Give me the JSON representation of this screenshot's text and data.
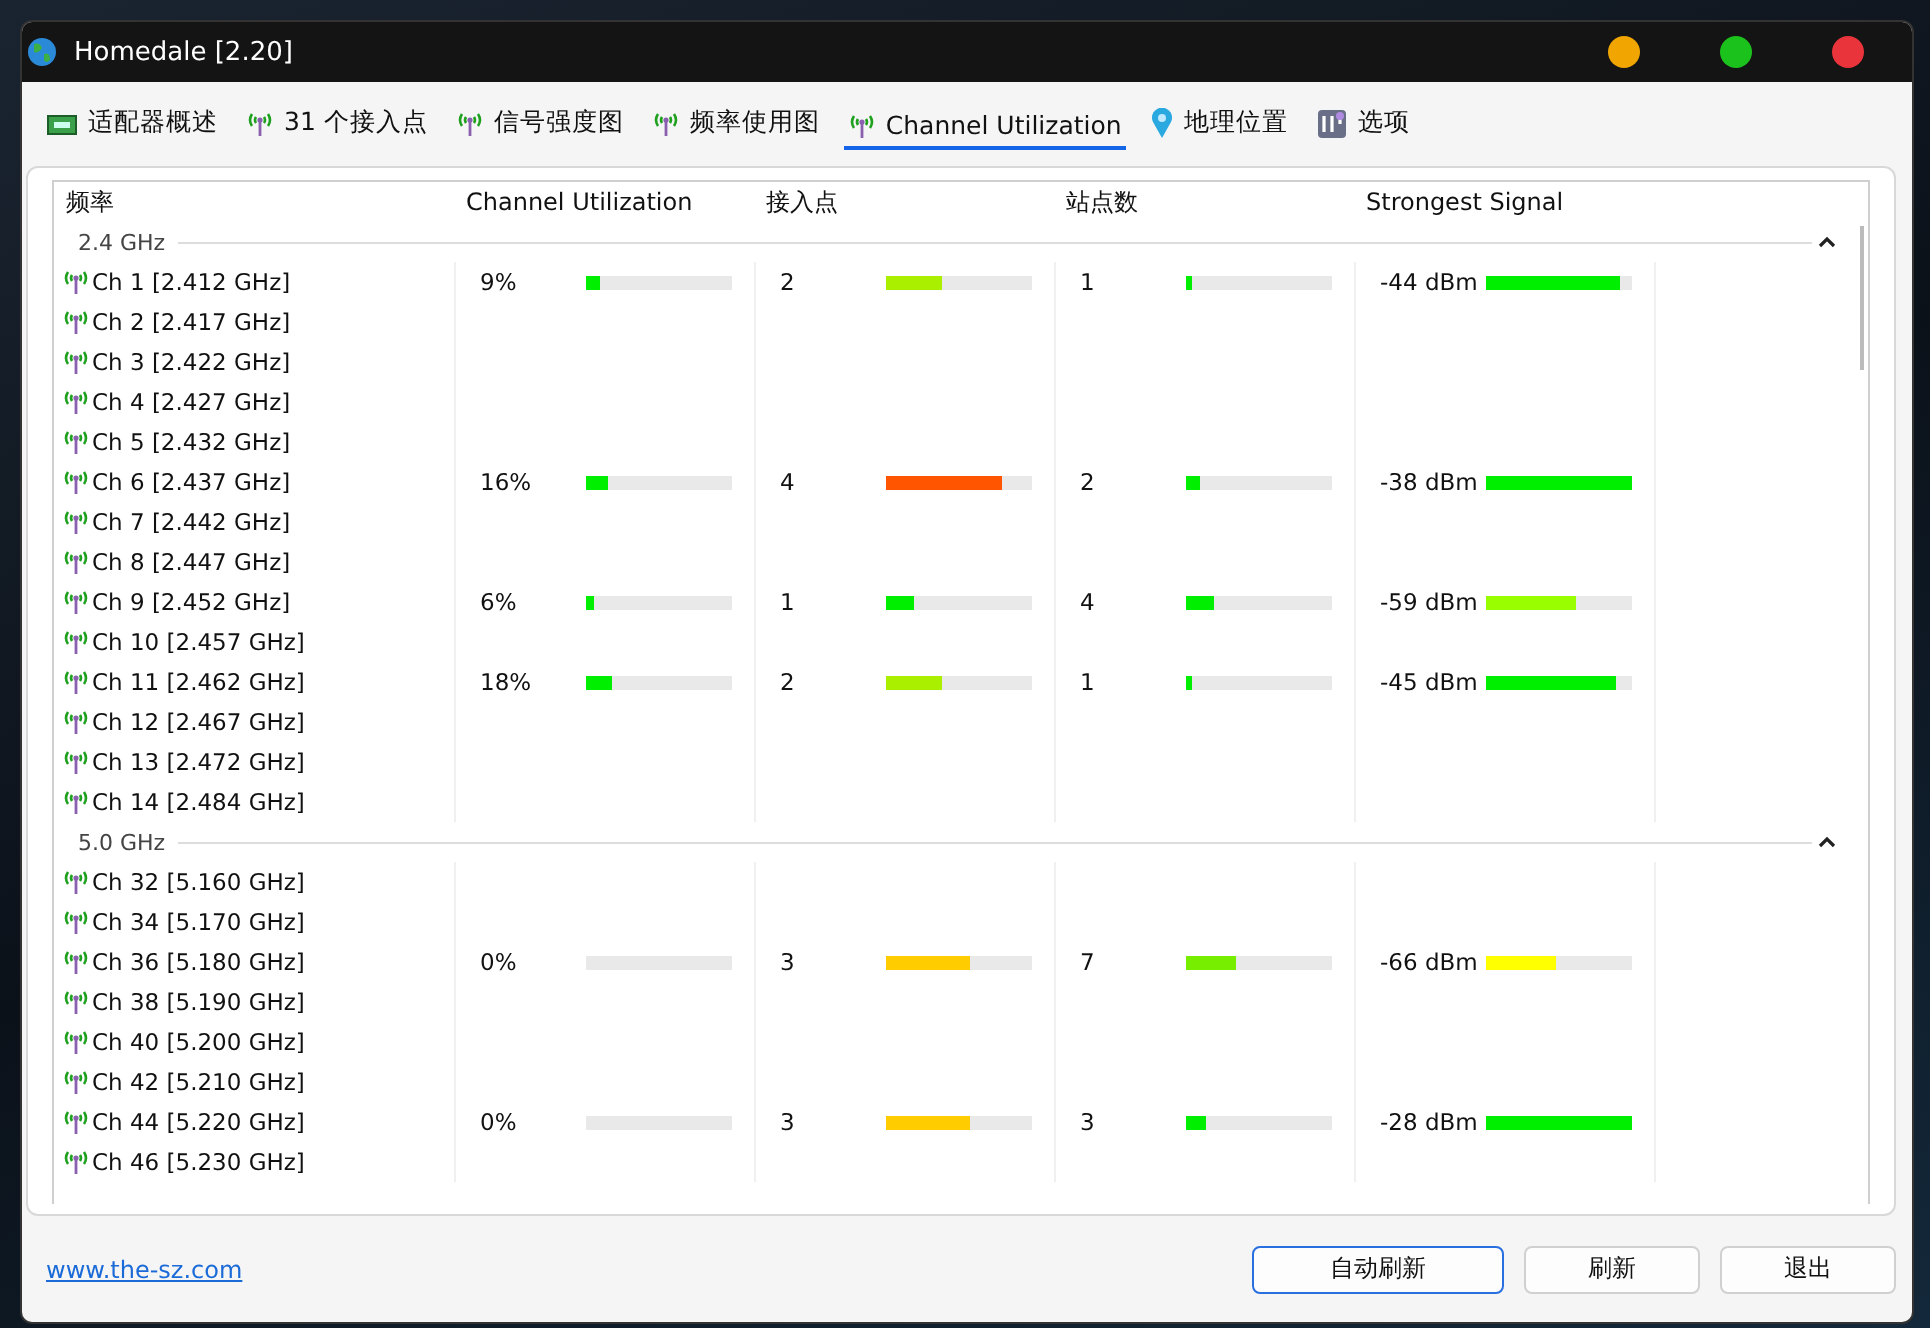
{
  "window": {
    "title": "Homedale [2.20]"
  },
  "tabs": [
    {
      "label": "适配器概述",
      "kind": "adapter",
      "selected": false
    },
    {
      "label": "31 个接入点",
      "kind": "antenna",
      "selected": false
    },
    {
      "label": "信号强度图",
      "kind": "antenna",
      "selected": false
    },
    {
      "label": "频率使用图",
      "kind": "antenna",
      "selected": false
    },
    {
      "label": "Channel Utilization",
      "kind": "antenna",
      "selected": true
    },
    {
      "label": "地理位置",
      "kind": "pin",
      "selected": false
    },
    {
      "label": "选项",
      "kind": "options",
      "selected": false
    }
  ],
  "table": {
    "columns": [
      "频率",
      "Channel Utilization",
      "接入点",
      "站点数",
      "Strongest Signal"
    ],
    "bands": [
      {
        "label": "2.4 GHz",
        "expanded": true,
        "channels": [
          {
            "name": "Ch 1 [2.412 GHz]",
            "utilization": {
              "text": "9%",
              "level": 0.09,
              "color": "#00ee00"
            },
            "access_points": {
              "text": "2",
              "level": 0.38,
              "color": "#aaee00"
            },
            "stations": {
              "text": "1",
              "level": 0.04,
              "color": "#00ee00"
            },
            "signal": {
              "text": "-44 dBm",
              "level": 0.92,
              "color": "#00ee00"
            }
          },
          {
            "name": "Ch 2 [2.417 GHz]"
          },
          {
            "name": "Ch 3 [2.422 GHz]"
          },
          {
            "name": "Ch 4 [2.427 GHz]"
          },
          {
            "name": "Ch 5 [2.432 GHz]"
          },
          {
            "name": "Ch 6 [2.437 GHz]",
            "utilization": {
              "text": "16%",
              "level": 0.15,
              "color": "#00ee00"
            },
            "access_points": {
              "text": "4",
              "level": 0.79,
              "color": "#ff5500"
            },
            "stations": {
              "text": "2",
              "level": 0.1,
              "color": "#00ee00"
            },
            "signal": {
              "text": "-38 dBm",
              "level": 1,
              "color": "#00ee00"
            }
          },
          {
            "name": "Ch 7 [2.442 GHz]"
          },
          {
            "name": "Ch 8 [2.447 GHz]"
          },
          {
            "name": "Ch 9 [2.452 GHz]",
            "utilization": {
              "text": "6%",
              "level": 0.06,
              "color": "#00ee00"
            },
            "access_points": {
              "text": "1",
              "level": 0.19,
              "color": "#00ee00"
            },
            "stations": {
              "text": "4",
              "level": 0.19,
              "color": "#00ee00"
            },
            "signal": {
              "text": "-59 dBm",
              "level": 0.62,
              "color": "#99ff00"
            }
          },
          {
            "name": "Ch 10 [2.457 GHz]"
          },
          {
            "name": "Ch 11 [2.462 GHz]",
            "utilization": {
              "text": "18%",
              "level": 0.18,
              "color": "#00ee00"
            },
            "access_points": {
              "text": "2",
              "level": 0.38,
              "color": "#aaee00"
            },
            "stations": {
              "text": "1",
              "level": 0.04,
              "color": "#00ee00"
            },
            "signal": {
              "text": "-45 dBm",
              "level": 0.89,
              "color": "#00ee00"
            }
          },
          {
            "name": "Ch 12 [2.467 GHz]"
          },
          {
            "name": "Ch 13 [2.472 GHz]"
          },
          {
            "name": "Ch 14 [2.484 GHz]"
          }
        ]
      },
      {
        "label": "5.0 GHz",
        "expanded": true,
        "channels": [
          {
            "name": "Ch 32 [5.160 GHz]"
          },
          {
            "name": "Ch 34 [5.170 GHz]"
          },
          {
            "name": "Ch 36 [5.180 GHz]",
            "utilization": {
              "text": "0%"
            },
            "access_points": {
              "text": "3",
              "level": 0.58,
              "color": "#ffcc00"
            },
            "stations": {
              "text": "7",
              "level": 0.34,
              "color": "#77ee00"
            },
            "signal": {
              "text": "-66 dBm",
              "level": 0.48,
              "color": "#ffff00"
            }
          },
          {
            "name": "Ch 38 [5.190 GHz]"
          },
          {
            "name": "Ch 40 [5.200 GHz]"
          },
          {
            "name": "Ch 42 [5.210 GHz]"
          },
          {
            "name": "Ch 44 [5.220 GHz]",
            "utilization": {
              "text": "0%"
            },
            "access_points": {
              "text": "3",
              "level": 0.58,
              "color": "#ffcc00"
            },
            "stations": {
              "text": "3",
              "level": 0.14,
              "color": "#00ee00"
            },
            "signal": {
              "text": "-28 dBm",
              "level": 1,
              "color": "#00ee00"
            }
          },
          {
            "name": "Ch 46 [5.230 GHz]"
          }
        ]
      }
    ]
  },
  "footer": {
    "link": "www.the-sz.com",
    "buttons": [
      {
        "label": "自动刷新",
        "default": true
      },
      {
        "label": "刷新",
        "default": false
      },
      {
        "label": "退出",
        "default": false
      }
    ]
  }
}
